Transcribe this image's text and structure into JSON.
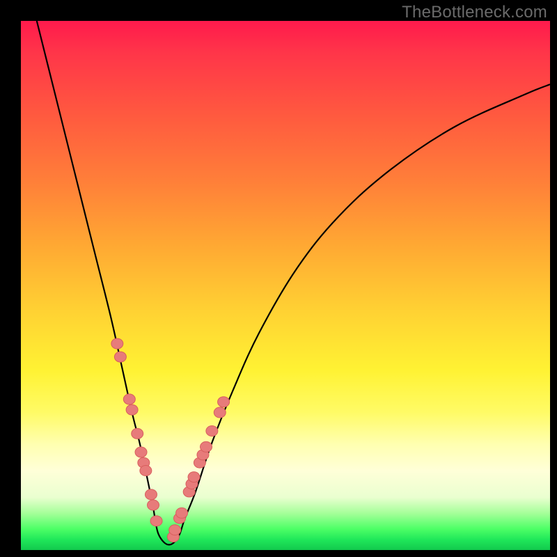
{
  "watermark": "TheBottleneck.com",
  "colors": {
    "frame": "#000000",
    "curve": "#000000",
    "marker_fill": "#e77b7a",
    "marker_stroke": "#d85f5d"
  },
  "chart_data": {
    "type": "line",
    "title": "",
    "xlabel": "",
    "ylabel": "",
    "xlim": [
      0,
      100
    ],
    "ylim": [
      0,
      100
    ],
    "grid": false,
    "legend": false,
    "series": [
      {
        "name": "bottleneck-curve",
        "x": [
          3,
          5,
          8,
          11,
          14,
          17,
          19,
          21,
          22.5,
          24,
          25,
          25.5,
          26,
          27,
          28,
          29,
          30,
          31,
          33,
          36,
          40,
          45,
          52,
          60,
          70,
          82,
          95,
          100
        ],
        "y": [
          100,
          92,
          80,
          68,
          56,
          44,
          35,
          26,
          20,
          13,
          8,
          5,
          3,
          1.5,
          1,
          1.5,
          3,
          6,
          11,
          20,
          30,
          41,
          53,
          63,
          72,
          80,
          86,
          88
        ]
      }
    ],
    "left_markers": {
      "x": [
        18.2,
        18.8,
        20.5,
        21.0,
        22.0,
        22.7,
        23.2,
        23.6,
        24.6,
        25.0,
        25.6
      ],
      "y": [
        39,
        36.5,
        28.5,
        26.5,
        22,
        18.5,
        16.5,
        15,
        10.5,
        8.5,
        5.5
      ]
    },
    "right_markers": {
      "x": [
        28.8,
        29.1,
        30.0,
        30.4,
        31.8,
        32.3,
        32.7,
        33.8,
        34.4,
        35.0,
        36.1,
        37.6,
        38.3
      ],
      "y": [
        2.5,
        3.8,
        6.0,
        7.0,
        11.0,
        12.5,
        13.8,
        16.5,
        18.0,
        19.5,
        22.5,
        26.0,
        28.0
      ]
    }
  }
}
